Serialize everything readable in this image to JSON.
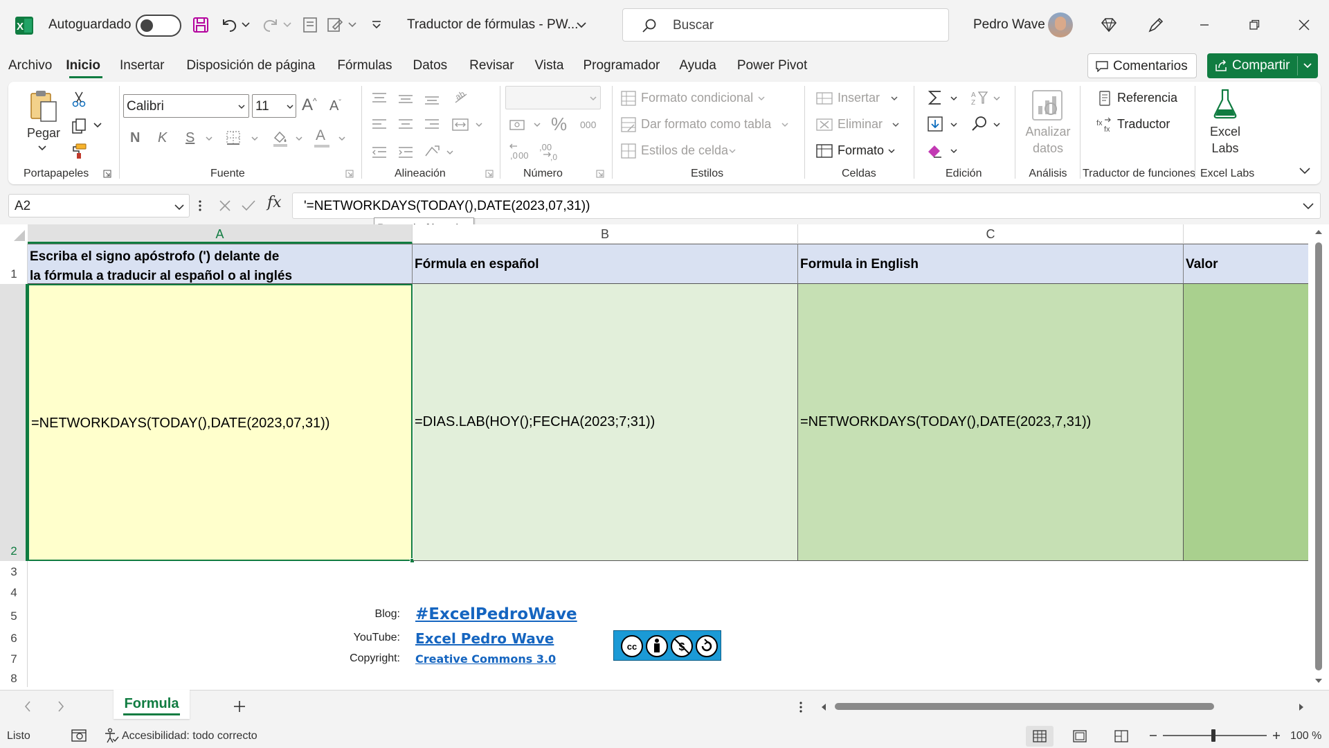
{
  "titlebar": {
    "autosave_label": "Autoguardado",
    "doc_title": "Traductor de fórmulas - PW...",
    "search_placeholder": "Buscar",
    "user_name": "Pedro Wave"
  },
  "menu": {
    "items": [
      "Archivo",
      "Inicio",
      "Insertar",
      "Disposición de página",
      "Fórmulas",
      "Datos",
      "Revisar",
      "Vista",
      "Programador",
      "Ayuda",
      "Power Pivot"
    ],
    "active": "Inicio",
    "comments_label": "Comentarios",
    "share_label": "Compartir"
  },
  "ribbon": {
    "clipboard": {
      "paste_label": "Pegar",
      "group_label": "Portapapeles"
    },
    "font": {
      "name": "Calibri",
      "size": "11",
      "bold": "N",
      "italic": "K",
      "underline": "S",
      "grow": "A",
      "shrink": "A",
      "color_letter": "A",
      "group_label": "Fuente"
    },
    "alignment": {
      "group_label": "Alineación"
    },
    "number": {
      "percent": "%",
      "thousands": "000",
      "dec_inc": "←,0 .00",
      "group_label": "Número"
    },
    "styles": {
      "conditional": "Formato condicional",
      "as_table": "Dar formato como tabla",
      "cell_styles": "Estilos de celda",
      "group_label": "Estilos"
    },
    "cells": {
      "insert": "Insertar",
      "delete": "Eliminar",
      "format": "Formato",
      "group_label": "Celdas"
    },
    "editing": {
      "group_label": "Edición"
    },
    "analysis": {
      "analyze_line1": "Analizar",
      "analyze_line2": "datos",
      "group_label": "Análisis"
    },
    "translator": {
      "reference": "Referencia",
      "translator": "Traductor",
      "group_label": "Traductor de funciones"
    },
    "labs": {
      "line1": "Excel",
      "line2": "Labs",
      "group_label": "Excel Labs"
    }
  },
  "formula_bar": {
    "name_box": "A2",
    "fx": "fx",
    "formula": "'=NETWORKDAYS(TODAY(),DATE(2023,07,31))",
    "tooltip": "Barra de fórmulas"
  },
  "grid": {
    "columns": [
      "A",
      "B",
      "C"
    ],
    "rows": [
      "1",
      "2",
      "3",
      "4",
      "5",
      "6",
      "7",
      "8"
    ],
    "header_row": {
      "a_line1": "Escriba el signo apóstrofo (') delante de",
      "a_line2": "la fórmula a traducir al español o al inglés",
      "b": "Fórmula en español",
      "c": "Formula in English",
      "d": "Valor"
    },
    "row2": {
      "a": "=NETWORKDAYS(TODAY(),DATE(2023,07,31))",
      "b": "=DIAS.LAB(HOY();FECHA(2023;7;31))",
      "c": "=NETWORKDAYS(TODAY(),DATE(2023,7,31))"
    },
    "credits": {
      "blog_label": "Blog:",
      "blog_link": "#ExcelPedroWave",
      "youtube_label": "YouTube:",
      "youtube_link": "Excel Pedro Wave",
      "copyright_label": "Copyright:",
      "copyright_link": "Creative Commons 3.0"
    }
  },
  "sheet_tabs": {
    "active": "Formula"
  },
  "status_bar": {
    "ready": "Listo",
    "accessibility": "Accesibilidad: todo correcto",
    "zoom": "100 %"
  },
  "colors": {
    "excel_green": "#107c41",
    "header_blue": "#d9e1f2",
    "cell_yellow": "#ffffcc",
    "cell_green_light": "#e2efda",
    "cell_green_mid": "#c6e0b4",
    "cell_green_dark": "#a9d08e",
    "link_blue": "#1565c0"
  }
}
